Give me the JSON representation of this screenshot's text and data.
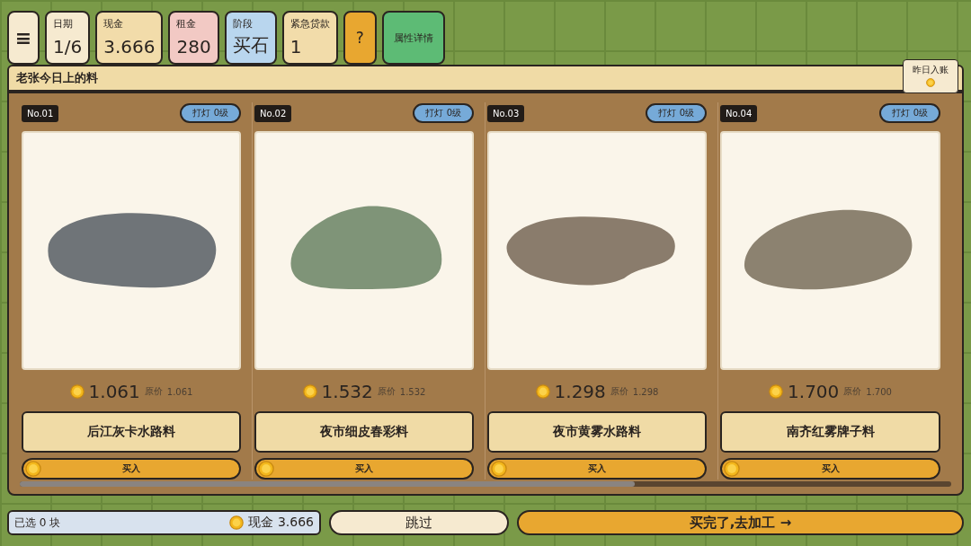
{
  "top_bar": {
    "menu_button": "≡",
    "stats": [
      {
        "kind": "stat",
        "label": "日期",
        "value": "1/6",
        "color": "#f6ead0"
      },
      {
        "kind": "stat",
        "label": "现金",
        "value": "3.666",
        "color": "#f2dcaa"
      },
      {
        "kind": "stat",
        "label": "租金",
        "value": "280",
        "color": "#f2c9c4"
      },
      {
        "kind": "stat",
        "label": "阶段",
        "value": "买石",
        "color": "#b9d6ee"
      },
      {
        "kind": "stat",
        "label": "紧急贷款",
        "value": "1",
        "color": "#f2dcaa"
      }
    ],
    "help_button": "?",
    "details_button": "属性详情"
  },
  "banner": {
    "title": "老张今日上的料",
    "note": "昨日入账"
  },
  "stones": [
    {
      "number": "No.01",
      "light": "打灯 0级",
      "color": "#6f7478",
      "price": "1.061",
      "original_label": "原价",
      "original_price": "1.061",
      "name": "后江灰卡水路料",
      "buy": "买入"
    },
    {
      "number": "No.02",
      "light": "打灯 0级",
      "color": "#7f9478",
      "price": "1.532",
      "original_label": "原价",
      "original_price": "1.532",
      "name": "夜市细皮春彩料",
      "buy": "买入"
    },
    {
      "number": "No.03",
      "light": "打灯 0级",
      "color": "#8a7c6c",
      "price": "1.298",
      "original_label": "原价",
      "original_price": "1.298",
      "name": "夜市黄雾水路料",
      "buy": "买入"
    },
    {
      "number": "No.04",
      "light": "打灯 0级",
      "color": "#8c8270",
      "price": "1.700",
      "original_label": "原价",
      "original_price": "1.700",
      "name": "南齐红雾牌子料",
      "buy": "买入"
    }
  ],
  "footer": {
    "selected": "已选 0 块",
    "cash": "现金 3.666",
    "skip_button": "跳过",
    "proceed_button": "买完了,去加工 →"
  }
}
